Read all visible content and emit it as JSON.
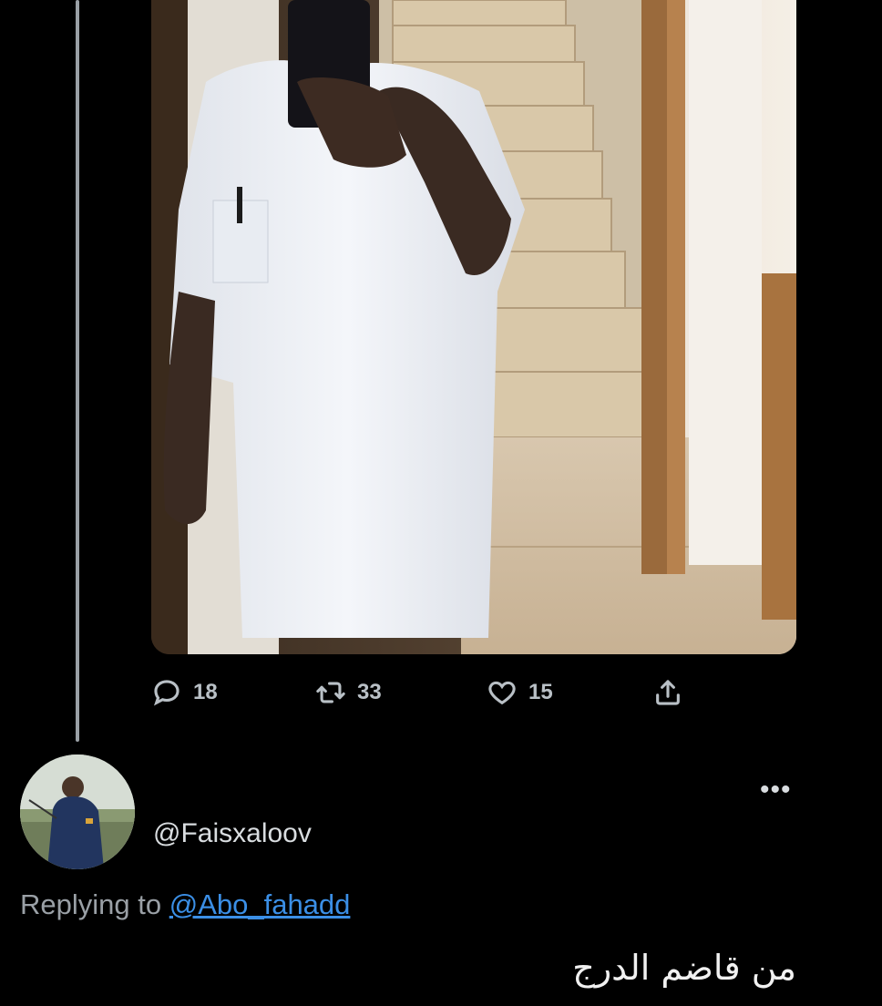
{
  "tweet": {
    "stats": {
      "replies": "18",
      "retweets": "33",
      "likes": "15"
    },
    "icons": {
      "reply": "speech-bubble-icon",
      "retweet": "retweet-arrows-icon",
      "like": "heart-icon",
      "share": "share-upload-icon"
    }
  },
  "reply": {
    "handle": "@Faisxaloov",
    "more": "•••",
    "replying_prefix": "Replying to",
    "replying_to": "@Abo_fahadd",
    "text": "من قاضم الدرج"
  },
  "colors": {
    "background": "#000000",
    "link": "#3b8fe6",
    "muted": "#9aa0a6"
  }
}
